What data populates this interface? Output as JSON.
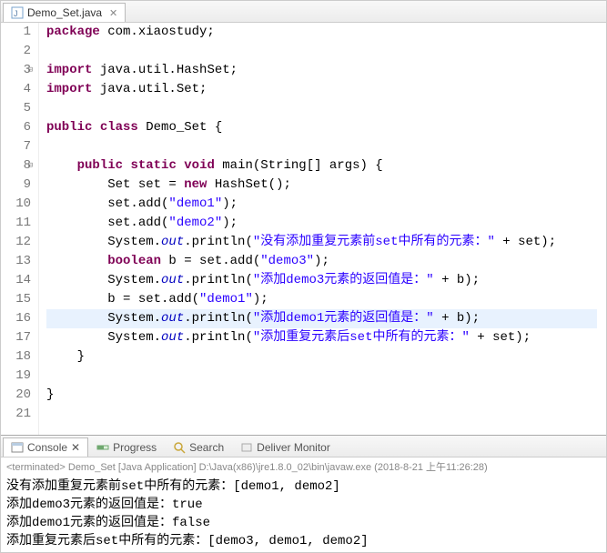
{
  "editor_tab": {
    "filename": "Demo_Set.java"
  },
  "code": {
    "lines": [
      {
        "n": 1,
        "html": "<span class='kw'>package</span> com.xiaostudy;"
      },
      {
        "n": 2,
        "html": ""
      },
      {
        "n": 3,
        "html": "<span class='kw'>import</span> java.util.HashSet;",
        "fold": true
      },
      {
        "n": 4,
        "html": "<span class='kw'>import</span> java.util.Set;"
      },
      {
        "n": 5,
        "html": ""
      },
      {
        "n": 6,
        "html": "<span class='kw'>public</span> <span class='kw'>class</span> Demo_Set {"
      },
      {
        "n": 7,
        "html": ""
      },
      {
        "n": 8,
        "html": "    <span class='kw'>public</span> <span class='kw'>static</span> <span class='kw'>void</span> main(String[] args) {",
        "fold": true
      },
      {
        "n": 9,
        "html": "        Set set = <span class='kw'>new</span> HashSet();"
      },
      {
        "n": 10,
        "html": "        set.add(<span class='str'>\"demo1\"</span>);"
      },
      {
        "n": 11,
        "html": "        set.add(<span class='str'>\"demo2\"</span>);"
      },
      {
        "n": 12,
        "html": "        System.<span class='field'>out</span>.println(<span class='str'>\"没有添加重复元素前set中所有的元素：\"</span> + set);"
      },
      {
        "n": 13,
        "html": "        <span class='kw'>boolean</span> b = set.add(<span class='str'>\"demo3\"</span>);"
      },
      {
        "n": 14,
        "html": "        System.<span class='field'>out</span>.println(<span class='str'>\"添加demo3元素的返回值是：\"</span> + b);"
      },
      {
        "n": 15,
        "html": "        b = set.add(<span class='str'>\"demo1\"</span>);"
      },
      {
        "n": 16,
        "html": "        System.<span class='field'>out</span>.println(<span class='str'>\"添加demo1元素的返回值是：\"</span> + b);",
        "hl": true
      },
      {
        "n": 17,
        "html": "        System.<span class='field'>out</span>.println(<span class='str'>\"添加重复元素后set中所有的元素：\"</span> + set);"
      },
      {
        "n": 18,
        "html": "    }"
      },
      {
        "n": 19,
        "html": ""
      },
      {
        "n": 20,
        "html": "}"
      },
      {
        "n": 21,
        "html": ""
      }
    ]
  },
  "console": {
    "tabs": {
      "console": "Console",
      "progress": "Progress",
      "search": "Search",
      "deliver": "Deliver Monitor"
    },
    "header": "<terminated> Demo_Set [Java Application] D:\\Java(x86)\\jre1.8.0_02\\bin\\javaw.exe (2018-8-21 上午11:26:28)",
    "output": [
      "没有添加重复元素前set中所有的元素：[demo1, demo2]",
      "添加demo3元素的返回值是：true",
      "添加demo1元素的返回值是：false",
      "添加重复元素后set中所有的元素：[demo3, demo1, demo2]"
    ]
  }
}
